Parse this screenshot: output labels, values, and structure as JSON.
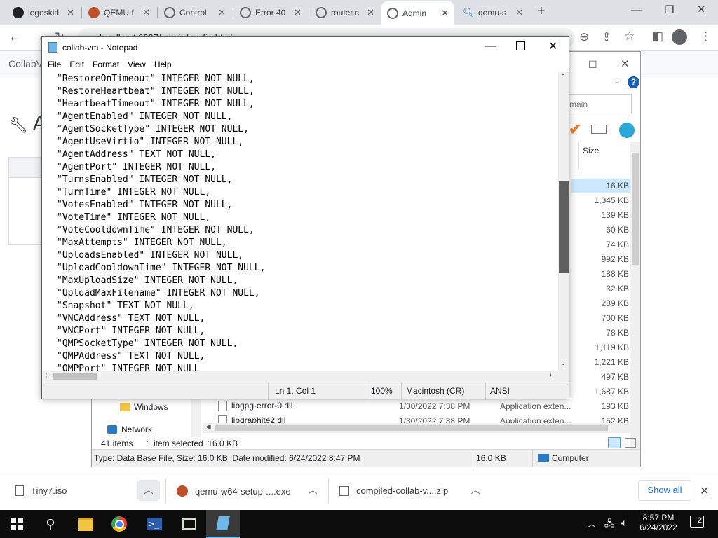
{
  "browser": {
    "tabs": [
      {
        "label": "legoskid",
        "icon": "github-icon"
      },
      {
        "label": "QEMU f",
        "icon": "qemu-icon"
      },
      {
        "label": "Control",
        "icon": "globe-icon"
      },
      {
        "label": "Error 40",
        "icon": "globe-icon"
      },
      {
        "label": "router.c",
        "icon": "globe-icon"
      },
      {
        "label": "Admin",
        "icon": "globe-icon"
      },
      {
        "label": "qemu-s",
        "icon": "search-icon"
      }
    ],
    "new_tab": "+",
    "address": "localhost:6007/admin/config.html",
    "page_app_label": "CollabV",
    "page_heading": "Ac"
  },
  "notepad": {
    "title": "collab-vm - Notepad",
    "menu": [
      "File",
      "Edit",
      "Format",
      "View",
      "Help"
    ],
    "lines": [
      "\"RestoreOnTimeout\" INTEGER NOT NULL,",
      "\"RestoreHeartbeat\" INTEGER NOT NULL,",
      "\"HeartbeatTimeout\" INTEGER NOT NULL,",
      "\"AgentEnabled\" INTEGER NOT NULL,",
      "\"AgentSocketType\" INTEGER NOT NULL,",
      "\"AgentUseVirtio\" INTEGER NOT NULL,",
      "\"AgentAddress\" TEXT NOT NULL,",
      "\"AgentPort\" INTEGER NOT NULL,",
      "\"TurnsEnabled\" INTEGER NOT NULL,",
      "\"TurnTime\" INTEGER NOT NULL,",
      "\"VotesEnabled\" INTEGER NOT NULL,",
      "\"VoteTime\" INTEGER NOT NULL,",
      "\"VoteCooldownTime\" INTEGER NOT NULL,",
      "\"MaxAttempts\" INTEGER NOT NULL,",
      "\"UploadsEnabled\" INTEGER NOT NULL,",
      "\"UploadCooldownTime\" INTEGER NOT NULL,",
      "\"MaxUploadSize\" INTEGER NOT NULL,",
      "\"UploadMaxFilename\" INTEGER NOT NULL,",
      "\"Snapshot\" TEXT NOT NULL,",
      "\"VNCAddress\" TEXT NOT NULL,",
      "\"VNCPort\" INTEGER NOT NULL,",
      "\"QMPSocketType\" INTEGER NOT NULL,",
      "\"QMPAddress\" TEXT NOT NULL,",
      "\"QMPPort\" INTEGER NOT NULL"
    ],
    "status": {
      "position": "Ln 1, Col 1",
      "zoom": "100%",
      "line_ending": "Macintosh (CR)",
      "encoding": "ANSI"
    }
  },
  "explorer": {
    "search_placeholder": "main",
    "size_header": "Size",
    "sizes": [
      "16 KB",
      "1,345 KB",
      "139 KB",
      "60 KB",
      "74 KB",
      "992 KB",
      "188 KB",
      "32 KB",
      "289 KB",
      "700 KB",
      "78 KB",
      "1,119 KB",
      "1,221 KB",
      "497 KB",
      "1,687 KB",
      "193 KB",
      "152 KB"
    ],
    "nav": [
      {
        "label": "Windows",
        "icon": "folder-icon"
      },
      {
        "label": "Network",
        "icon": "network-icon"
      }
    ],
    "files": [
      {
        "name": "libgpg-error-0.dll",
        "date": "1/30/2022 7:38 PM",
        "type": "Application exten..."
      },
      {
        "name": "libgraphite2.dll",
        "date": "1/30/2022 7:38 PM",
        "type": "Application exten..."
      }
    ],
    "item_count": "41 items",
    "selected_info": "1 item selected  16.0 KB",
    "status_left": "Type: Data Base File, Size: 16.0 KB, Date modified: 6/24/2022 8:47 PM",
    "status_size": "16.0 KB",
    "status_location": "Computer"
  },
  "downloads": {
    "items": [
      "Tiny7.iso",
      "qemu-w64-setup-....exe",
      "compiled-collab-v....zip"
    ],
    "show_all": "Show all"
  },
  "taskbar": {
    "time": "8:57 PM",
    "date": "6/24/2022",
    "notifications": "2"
  }
}
